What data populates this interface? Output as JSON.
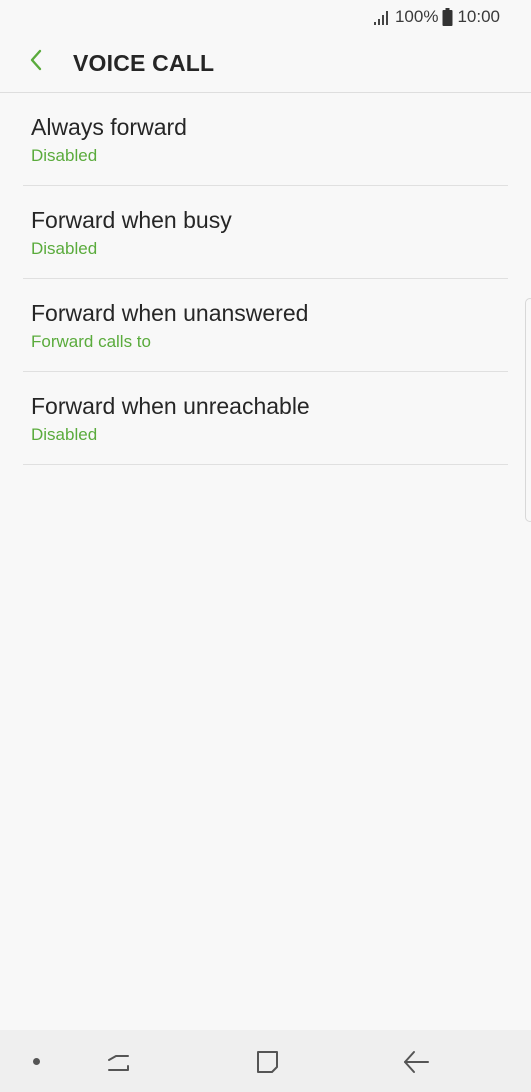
{
  "status_bar": {
    "battery_percent": "100%",
    "time": "10:00",
    "signal_icon": "signal-icon",
    "battery_icon": "battery-icon"
  },
  "header": {
    "title": "VOICE CALL",
    "back_icon": "chevron-left-icon"
  },
  "colors": {
    "accent": "#5aab3c",
    "title_text": "#262626",
    "background": "#f8f8f8",
    "divider": "#e0e0e0"
  },
  "items": [
    {
      "title": "Always forward",
      "subtitle": "Disabled"
    },
    {
      "title": "Forward when busy",
      "subtitle": "Disabled"
    },
    {
      "title": "Forward when unanswered",
      "subtitle": "Forward calls to"
    },
    {
      "title": "Forward when unreachable",
      "subtitle": "Disabled"
    }
  ],
  "nav_bar": {
    "icons": [
      "dot-icon",
      "recents-icon",
      "home-icon",
      "back-arrow-icon"
    ]
  }
}
